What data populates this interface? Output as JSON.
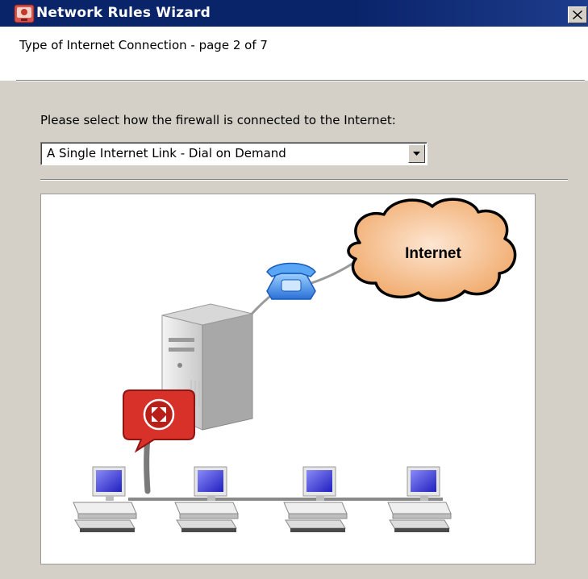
{
  "window": {
    "title": "Network Rules Wizard",
    "close_symbol": "×"
  },
  "header": {
    "page_title": "Type of Internet Connection - page 2 of 7"
  },
  "form": {
    "prompt": "Please select how the firewall is connected to the Internet:",
    "connection_type": {
      "selected": "A Single Internet Link - Dial on Demand"
    }
  },
  "diagram": {
    "cloud_label": "Internet",
    "icons": [
      "internet-cloud-icon",
      "dialup-phone-icon",
      "firewall-server-icon",
      "router-badge-icon",
      "client-computer-icon"
    ],
    "client_count": 4
  },
  "colors": {
    "titlebar": "#0a246a",
    "dialog_bg": "#d4d0c8",
    "cloud_fill": "#f0b482",
    "phone": "#3c86e8",
    "router_badge": "#d8312a",
    "monitor_screen": "#3c3cd8"
  }
}
